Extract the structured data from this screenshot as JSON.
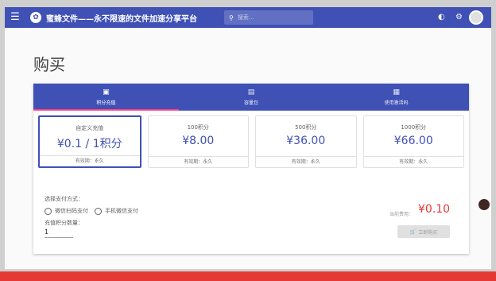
{
  "appbar": {
    "menu_icon": "menu-icon",
    "logo_icon": "bee-logo-icon",
    "title": "蜜蜂文件——永不限速的文件加速分享平台",
    "search_placeholder": "搜索...",
    "search_icon": "search-icon",
    "icons": [
      "theme-toggle-icon",
      "gear-icon"
    ]
  },
  "page": {
    "title": "购买"
  },
  "tabs": [
    {
      "label": "积分充值",
      "icon": "wallet-icon",
      "active": true
    },
    {
      "label": "容量包",
      "icon": "storage-icon",
      "active": false
    },
    {
      "label": "使用激活码",
      "icon": "ticket-icon",
      "active": false
    }
  ],
  "packages": [
    {
      "name": "自定义充值",
      "price": "¥0.1 / 1积分",
      "validity": "有效期：永久",
      "selected": true
    },
    {
      "name": "100积分",
      "price": "¥8.00",
      "validity": "有效期：永久",
      "selected": false
    },
    {
      "name": "500积分",
      "price": "¥36.00",
      "validity": "有效期：永久",
      "selected": false
    },
    {
      "name": "1000积分",
      "price": "¥66.00",
      "validity": "有效期：永久",
      "selected": false
    }
  ],
  "payment": {
    "label": "选择支付方式：",
    "options": [
      "微信扫码支付",
      "手机微信支付"
    ]
  },
  "quantity": {
    "label": "充值积分数量：",
    "value": "1"
  },
  "cost": {
    "label": "当前费用：",
    "value": "¥0.10"
  },
  "buy_button": {
    "icon": "cart-icon",
    "label": "立即购买"
  },
  "colors": {
    "primary": "#3f51b5",
    "accent": "#ff4081",
    "price_red": "#e53935"
  }
}
